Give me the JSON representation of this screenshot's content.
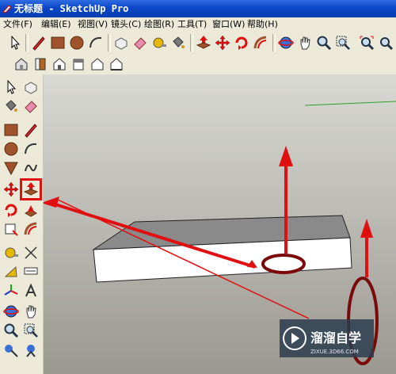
{
  "window": {
    "title": "无标题 - SketchUp Pro"
  },
  "menu": [
    "文件(F)",
    "编辑(E)",
    "视图(V)",
    "镜头(C)",
    "绘图(R)",
    "工具(T)",
    "窗口(W)",
    "帮助(H)"
  ],
  "watermark": {
    "brand": "溜溜自学",
    "url": "ZIXUE.3D66.COM"
  },
  "colors": {
    "highlight": "#e01010",
    "canvas_top": "#d9d9d4",
    "canvas_bottom": "#9a9890"
  }
}
